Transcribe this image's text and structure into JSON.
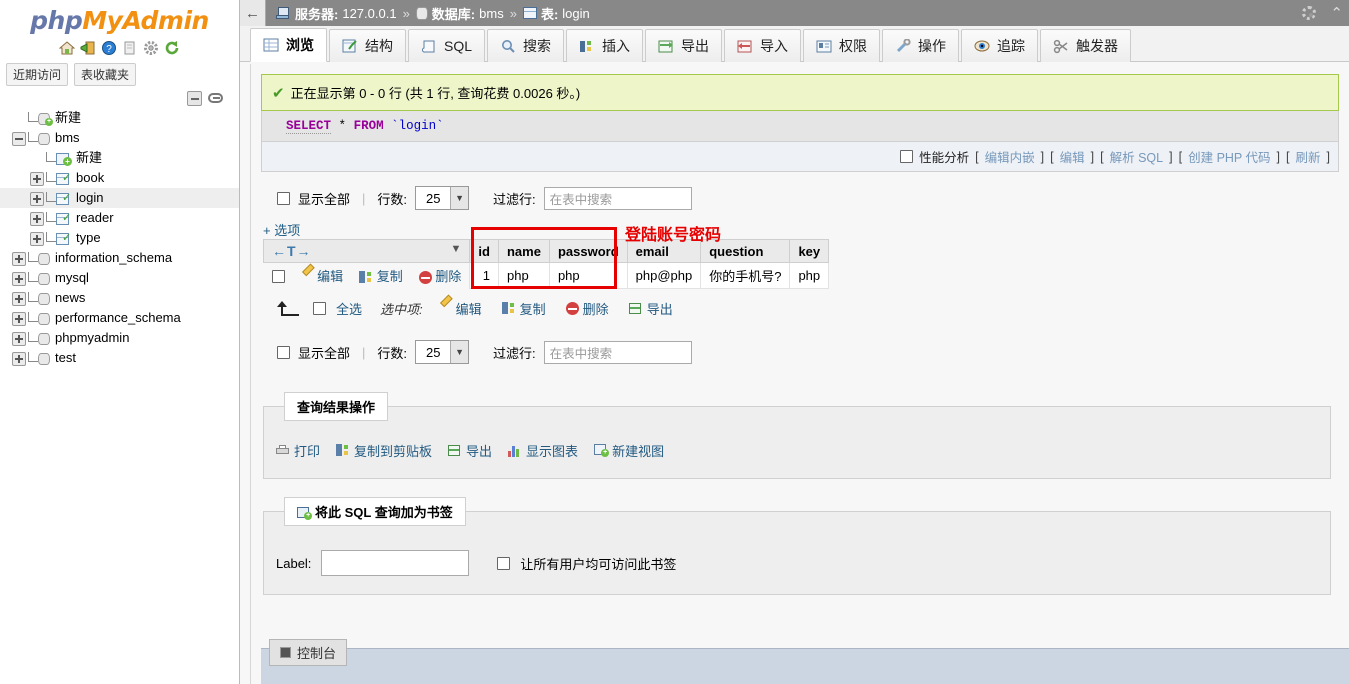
{
  "app": {
    "logo_php": "php",
    "logo_my": "My",
    "logo_admin": "Admin"
  },
  "sidebar": {
    "icons": [
      "home-icon",
      "logout-icon",
      "help-icon",
      "docs-icon",
      "settings-icon",
      "reload-icon"
    ],
    "quick_tabs": [
      {
        "label": "近期访问",
        "name": "recent-tables-tab"
      },
      {
        "label": "表收藏夹",
        "name": "favorite-tables-tab"
      }
    ],
    "tree": [
      {
        "label": "新建",
        "level": 1,
        "type": "new-db",
        "expander": "none",
        "selected": false
      },
      {
        "label": "bms",
        "level": 1,
        "type": "database",
        "expander": "minus",
        "selected": false
      },
      {
        "label": "新建",
        "level": 2,
        "type": "new-table",
        "expander": "none",
        "selected": false
      },
      {
        "label": "book",
        "level": 2,
        "type": "table",
        "expander": "plus",
        "selected": false
      },
      {
        "label": "login",
        "level": 2,
        "type": "table",
        "expander": "plus",
        "selected": true
      },
      {
        "label": "reader",
        "level": 2,
        "type": "table",
        "expander": "plus",
        "selected": false
      },
      {
        "label": "type",
        "level": 2,
        "type": "table",
        "expander": "plus",
        "selected": false
      },
      {
        "label": "information_schema",
        "level": 1,
        "type": "database",
        "expander": "plus",
        "selected": false
      },
      {
        "label": "mysql",
        "level": 1,
        "type": "database",
        "expander": "plus",
        "selected": false
      },
      {
        "label": "news",
        "level": 1,
        "type": "database",
        "expander": "plus",
        "selected": false
      },
      {
        "label": "performance_schema",
        "level": 1,
        "type": "database",
        "expander": "plus",
        "selected": false
      },
      {
        "label": "phpmyadmin",
        "level": 1,
        "type": "database",
        "expander": "plus",
        "selected": false
      },
      {
        "label": "test",
        "level": 1,
        "type": "database",
        "expander": "plus",
        "selected": false
      }
    ]
  },
  "topbar": {
    "back_glyph": "←",
    "server_label": "服务器:",
    "server_value": "127.0.0.1",
    "db_label": "数据库:",
    "db_value": "bms",
    "table_label": "表:",
    "table_value": "login",
    "separator": "»",
    "settings_icon": "gear-icon",
    "collapse_icon": "collapse-icon"
  },
  "tabs": [
    {
      "label": "浏览",
      "icon": "browse-icon",
      "active": true
    },
    {
      "label": "结构",
      "icon": "structure-icon",
      "active": false
    },
    {
      "label": "SQL",
      "icon": "sql-icon",
      "active": false
    },
    {
      "label": "搜索",
      "icon": "search-icon",
      "active": false
    },
    {
      "label": "插入",
      "icon": "insert-icon",
      "active": false
    },
    {
      "label": "导出",
      "icon": "export-icon",
      "active": false
    },
    {
      "label": "导入",
      "icon": "import-icon",
      "active": false
    },
    {
      "label": "权限",
      "icon": "privileges-icon",
      "active": false
    },
    {
      "label": "操作",
      "icon": "operations-icon",
      "active": false
    },
    {
      "label": "追踪",
      "icon": "tracking-icon",
      "active": false
    },
    {
      "label": "触发器",
      "icon": "triggers-icon",
      "active": false
    }
  ],
  "result": {
    "success_message": "正在显示第 0 - 0 行 (共 1 行, 查询花费 0.0026 秒。)",
    "sql_keyword_select": "SELECT",
    "sql_star": "*",
    "sql_keyword_from": "FROM",
    "sql_table": "`login`",
    "profiling_label": "性能分析",
    "tool_links": [
      "编辑内嵌",
      "编辑",
      "解析 SQL",
      "创建 PHP 代码",
      "刷新"
    ]
  },
  "options_top": {
    "show_all_label": "显示全部",
    "rows_label": "行数:",
    "rows_value": "25",
    "filter_label": "过滤行:",
    "filter_placeholder": "在表中搜索",
    "filter_value": ""
  },
  "options_bottom": {
    "show_all_label": "显示全部",
    "rows_label": "行数:",
    "rows_value": "25",
    "filter_label": "过滤行:",
    "filter_placeholder": "在表中搜索",
    "filter_value": ""
  },
  "options_toggle": "+ 选项",
  "table": {
    "sort_icons": "←T→",
    "columns": [
      "id",
      "name",
      "password",
      "email",
      "question",
      "key"
    ],
    "rows": [
      {
        "edit_label": "编辑",
        "copy_label": "复制",
        "delete_label": "删除",
        "cells": [
          "1",
          "php",
          "php",
          "php@php",
          "你的手机号?",
          "php"
        ]
      }
    ]
  },
  "annotation": {
    "text": "登陆账号密码",
    "color": "#e60000"
  },
  "bulk_actions": {
    "select_all_label": "全选",
    "with_selected_label": "选中项:",
    "actions": [
      {
        "label": "编辑",
        "icon": "pencil-icon"
      },
      {
        "label": "复制",
        "icon": "copy-icon"
      },
      {
        "label": "删除",
        "icon": "delete-icon"
      },
      {
        "label": "导出",
        "icon": "export-icon"
      }
    ]
  },
  "query_ops": {
    "legend": "查询结果操作",
    "items": [
      {
        "label": "打印",
        "icon": "print-icon"
      },
      {
        "label": "复制到剪贴板",
        "icon": "copy-icon"
      },
      {
        "label": "导出",
        "icon": "export-icon"
      },
      {
        "label": "显示图表",
        "icon": "chart-icon"
      },
      {
        "label": "新建视图",
        "icon": "create-view-icon"
      }
    ]
  },
  "bookmark": {
    "legend": "将此 SQL 查询加为书签",
    "legend_icon": "bookmark-icon",
    "label_text": "Label:",
    "label_value": "",
    "share_label": "让所有用户均可访问此书签"
  },
  "console": {
    "label": "控制台",
    "icon": "console-icon"
  }
}
